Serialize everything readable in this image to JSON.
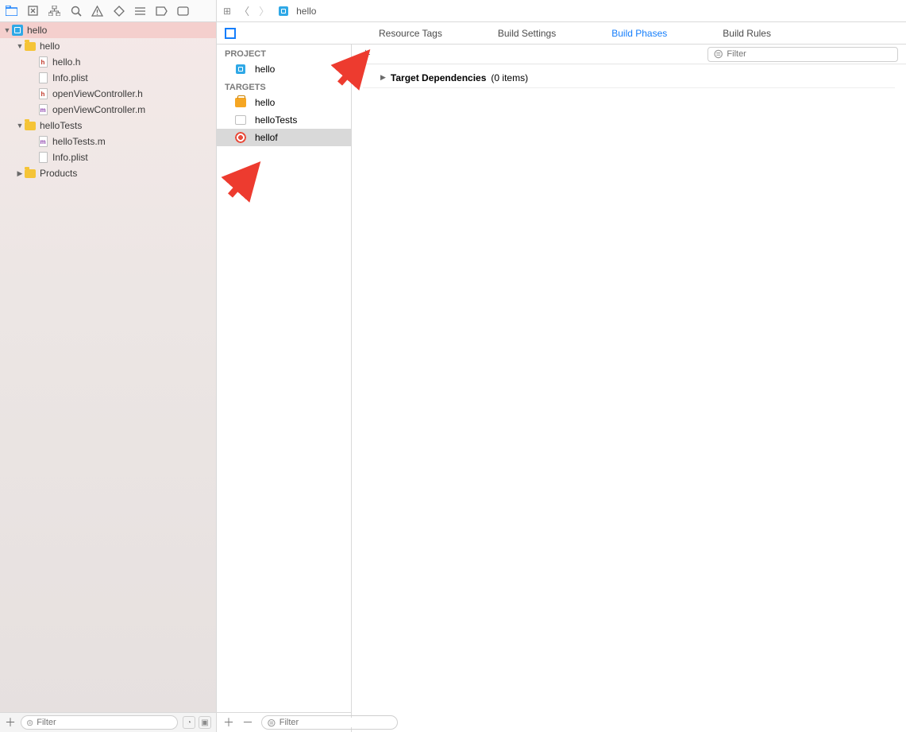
{
  "nav": {
    "filter_placeholder": "Filter",
    "tree": {
      "root": "hello",
      "group1": "hello",
      "files1": [
        "hello.h",
        "Info.plist",
        "openViewController.h",
        "openViewController.m"
      ],
      "file_kinds1": [
        "h",
        "",
        "h",
        "m"
      ],
      "group2": "helloTests",
      "files2": [
        "helloTests.m",
        "Info.plist"
      ],
      "file_kinds2": [
        "m",
        ""
      ],
      "group3": "Products"
    }
  },
  "jump": {
    "crumb": "hello"
  },
  "tabs": {
    "t0": "Resource Tags",
    "t1": "Build Settings",
    "t2": "Build Phases",
    "t3": "Build Rules"
  },
  "pt": {
    "section_project": "PROJECT",
    "section_targets": "TARGETS",
    "project": "hello",
    "targets": [
      "hello",
      "helloTests",
      "hellof"
    ],
    "filter_placeholder": "Filter"
  },
  "phases": {
    "search_placeholder": "Filter",
    "row0_title": "Target Dependencies",
    "row0_count": "(0 items)"
  }
}
